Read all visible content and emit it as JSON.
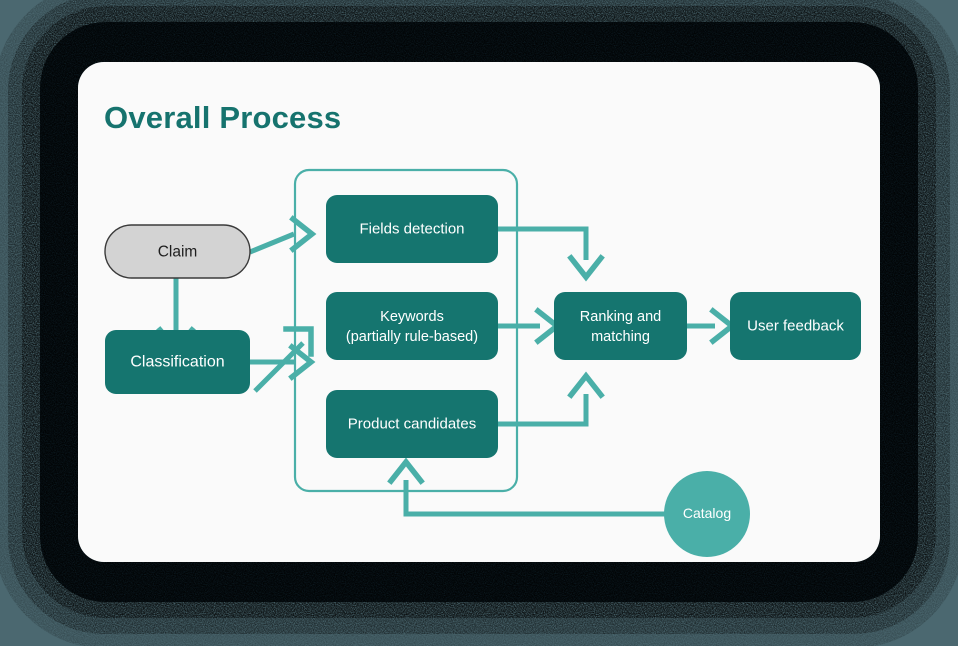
{
  "page": {
    "title": "Overall Process",
    "title_color": "#16736e",
    "card_background": "#fafafa",
    "canvas_background": "#4b6870"
  },
  "palette": {
    "node_fill": "#15756f",
    "node_text": "#ffffff",
    "accent_arrow": "#4aafa8",
    "input_pill_fill": "#d3d3d3",
    "input_pill_border": "#3a3a3a",
    "input_pill_text": "#1e1e1e",
    "group_border": "#4aafa8",
    "catalog_fill": "#4aafa8"
  },
  "diagram": {
    "type": "flowchart",
    "nodes": [
      {
        "id": "claim",
        "label": "Claim",
        "shape": "pill",
        "style": "gray"
      },
      {
        "id": "classification",
        "label": "Classification",
        "shape": "rect",
        "style": "teal"
      },
      {
        "id": "fields",
        "label": "Fields detection",
        "shape": "rect",
        "style": "teal"
      },
      {
        "id": "keywords",
        "label_line1": "Keywords",
        "label_line2": "(partially rule-based)",
        "shape": "rect",
        "style": "teal"
      },
      {
        "id": "products",
        "label": "Product candidates",
        "shape": "rect",
        "style": "teal"
      },
      {
        "id": "ranking",
        "label_line1": "Ranking and",
        "label_line2": "matching",
        "shape": "rect",
        "style": "teal"
      },
      {
        "id": "feedback",
        "label": "User feedback",
        "shape": "rect",
        "style": "teal"
      },
      {
        "id": "catalog",
        "label": "Catalog",
        "shape": "circle",
        "style": "accent"
      }
    ],
    "group": {
      "id": "extraction-group",
      "label": "",
      "contains": [
        "fields",
        "keywords",
        "products"
      ]
    },
    "edges": [
      {
        "from": "claim",
        "to": "fields",
        "label": ""
      },
      {
        "from": "claim",
        "to": "classification",
        "label": ""
      },
      {
        "from": "classification",
        "to": "keywords",
        "label": ""
      },
      {
        "from": "classification",
        "to": "products",
        "label": ""
      },
      {
        "from": "fields",
        "to": "ranking",
        "label": ""
      },
      {
        "from": "keywords",
        "to": "ranking",
        "label": ""
      },
      {
        "from": "products",
        "to": "ranking",
        "label": ""
      },
      {
        "from": "ranking",
        "to": "feedback",
        "label": ""
      },
      {
        "from": "catalog",
        "to": "products",
        "label": ""
      }
    ]
  }
}
